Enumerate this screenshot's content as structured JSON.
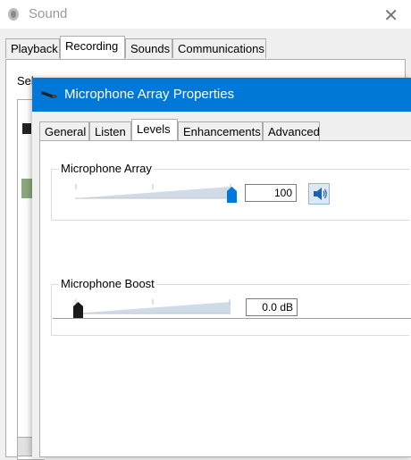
{
  "sound_window": {
    "title": "Sound",
    "tabs": [
      {
        "label": "Playback"
      },
      {
        "label": "Recording"
      },
      {
        "label": "Sounds"
      },
      {
        "label": "Communications"
      }
    ],
    "active_tab": "Recording",
    "partial_text": "Sel"
  },
  "mic_window": {
    "title": "Microphone Array Properties",
    "tabs": [
      {
        "label": "General"
      },
      {
        "label": "Listen"
      },
      {
        "label": "Levels"
      },
      {
        "label": "Enhancements"
      },
      {
        "label": "Advanced"
      }
    ],
    "active_tab": "Levels",
    "levels": {
      "microphone_array": {
        "label": "Microphone Array",
        "value": "100",
        "level_fraction": 1.0,
        "speaker_icon": "speaker-icon"
      },
      "microphone_boost": {
        "label": "Microphone Boost",
        "value": "0.0 dB",
        "level_fraction": 0.0
      }
    }
  },
  "colors": {
    "titlebar_active": "#0078d7",
    "slider_thumb_active": "#0078d7",
    "slider_thumb_boost": "#1a1a1a"
  }
}
